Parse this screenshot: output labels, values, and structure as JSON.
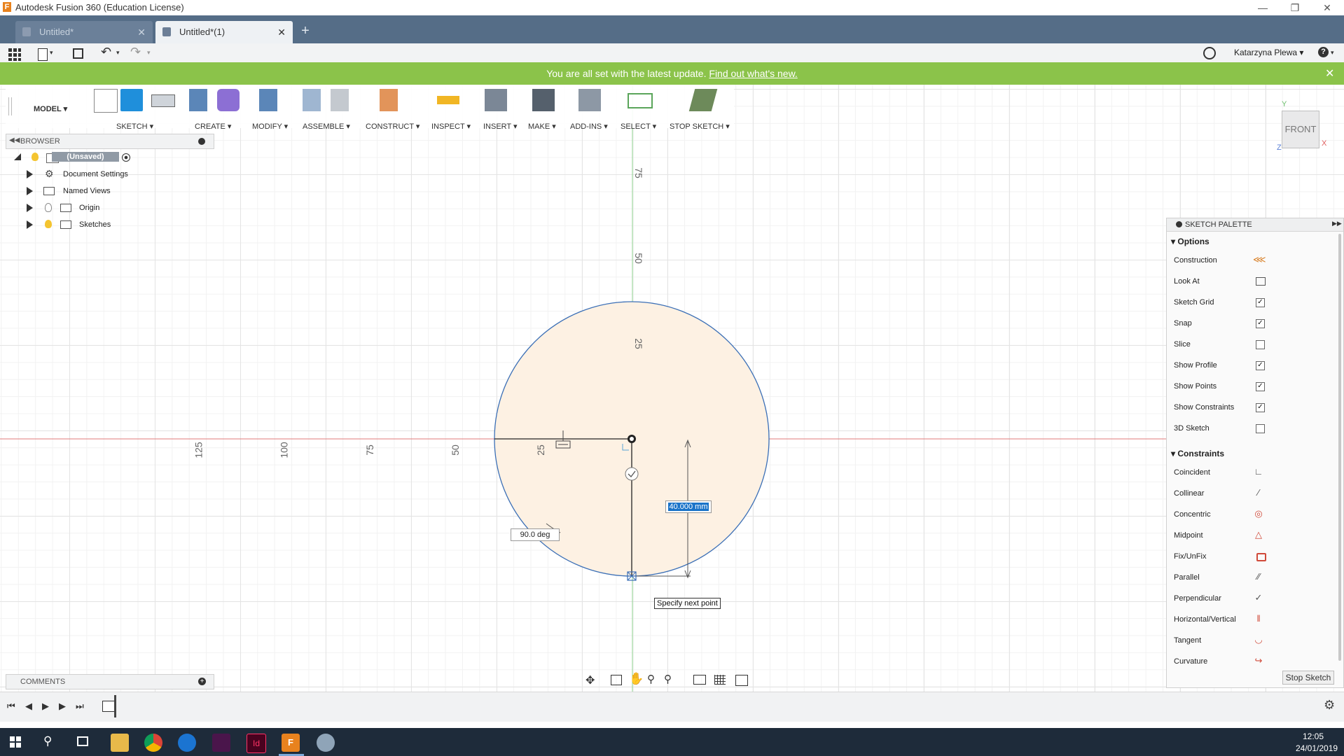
{
  "window": {
    "title": "Autodesk Fusion 360 (Education License)"
  },
  "tabs": [
    {
      "label": "Untitled*"
    },
    {
      "label": "Untitled*(1)"
    }
  ],
  "quick_access": {
    "user": "Katarzyna Plewa ▾",
    "help": "?"
  },
  "banner": {
    "message": "You are all set with the latest update.",
    "link": "Find out what's new."
  },
  "toolbar": {
    "workspace": "MODEL ▾",
    "groups": [
      "SKETCH ▾",
      "CREATE ▾",
      "MODIFY ▾",
      "ASSEMBLE ▾",
      "CONSTRUCT ▾",
      "INSPECT ▾",
      "INSERT ▾",
      "MAKE ▾",
      "ADD-INS ▾",
      "SELECT ▾",
      "STOP SKETCH ▾"
    ]
  },
  "browser": {
    "title": "BROWSER",
    "root": "(Unsaved)",
    "items": [
      {
        "label": "Document Settings",
        "icon": "gear-icon"
      },
      {
        "label": "Named Views",
        "icon": "folder-icon"
      },
      {
        "label": "Origin",
        "icon": "folder-icon"
      },
      {
        "label": "Sketches",
        "icon": "folder-icon"
      }
    ]
  },
  "comments": {
    "title": "COMMENTS"
  },
  "canvas": {
    "axis_labels_h": [
      "125",
      "100",
      "75",
      "50",
      "25"
    ],
    "axis_labels_v": [
      "75",
      "50",
      "25"
    ],
    "angle_dim": "90.0 deg",
    "length_dim": "40.000 mm",
    "tooltip": "Specify next point",
    "viewcube": "FRONT",
    "axis_y": "Y",
    "axis_x": "X",
    "axis_z": "Z"
  },
  "palette": {
    "title": "SKETCH PALETTE",
    "options_label": "Options",
    "options": [
      {
        "label": "Construction",
        "type": "icon",
        "icon": "construction-icon"
      },
      {
        "label": "Look At",
        "type": "icon",
        "icon": "look-at-icon"
      },
      {
        "label": "Sketch Grid",
        "type": "check",
        "checked": true
      },
      {
        "label": "Snap",
        "type": "check",
        "checked": true
      },
      {
        "label": "Slice",
        "type": "check",
        "checked": false
      },
      {
        "label": "Show Profile",
        "type": "check",
        "checked": true
      },
      {
        "label": "Show Points",
        "type": "check",
        "checked": true
      },
      {
        "label": "Show Constraints",
        "type": "check",
        "checked": true
      },
      {
        "label": "3D Sketch",
        "type": "check",
        "checked": false
      }
    ],
    "constraints_label": "Constraints",
    "constraints": [
      {
        "label": "Coincident",
        "icon": "coincident-icon"
      },
      {
        "label": "Collinear",
        "icon": "collinear-icon"
      },
      {
        "label": "Concentric",
        "icon": "concentric-icon"
      },
      {
        "label": "Midpoint",
        "icon": "midpoint-icon"
      },
      {
        "label": "Fix/UnFix",
        "icon": "lock-icon"
      },
      {
        "label": "Parallel",
        "icon": "parallel-icon"
      },
      {
        "label": "Perpendicular",
        "icon": "perpendicular-icon"
      },
      {
        "label": "Horizontal/Vertical",
        "icon": "horizontal-vertical-icon"
      },
      {
        "label": "Tangent",
        "icon": "tangent-icon"
      },
      {
        "label": "Curvature",
        "icon": "curvature-icon"
      }
    ],
    "stop_button": "Stop Sketch"
  },
  "taskbar": {
    "time": "12:05",
    "date": "24/01/2019"
  },
  "colors": {
    "banner": "#8bc34a",
    "tabbar": "#556d87",
    "accent": "#1f8fdb",
    "profile_fill": "#fdf1e3",
    "circle_stroke": "#3b6fb6"
  }
}
